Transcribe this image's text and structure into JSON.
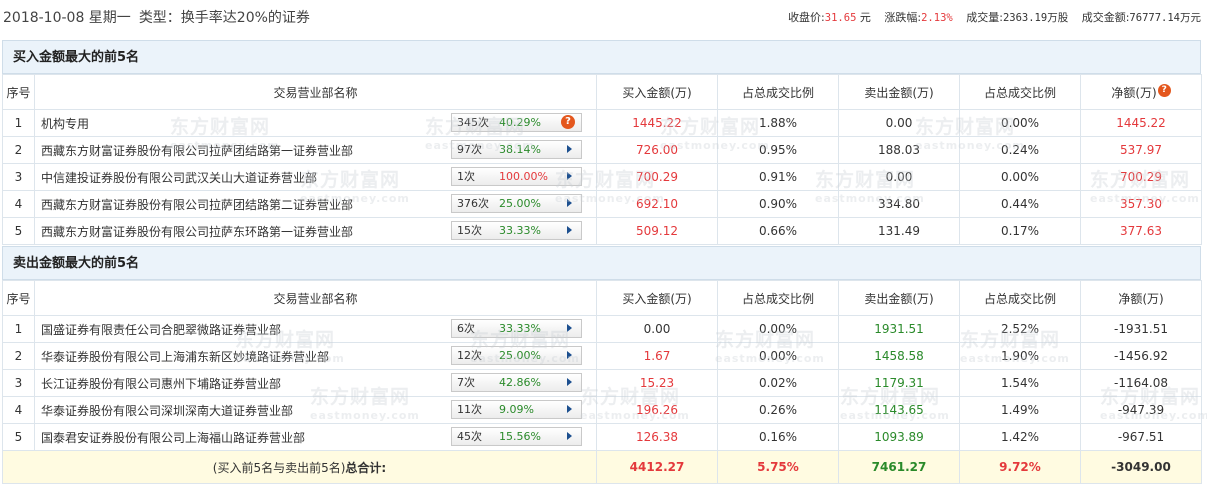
{
  "header": {
    "date": "2018-10-08 星期一",
    "type": "类型：换手率达20%的证券",
    "close_label": "收盘价:",
    "close_value": "31.65",
    "close_unit": "元",
    "change_label": "涨跌幅:",
    "change_value": "2.13%",
    "volume_label": "成交量:",
    "volume_value": "2363.19万股",
    "amount_label": "成交金额:",
    "amount_value": "76777.14万元"
  },
  "columns": {
    "seq": "序号",
    "name": "交易营业部名称",
    "buy": "买入金额(万)",
    "buy_pct": "占总成交比例",
    "sell": "卖出金额(万)",
    "sell_pct": "占总成交比例",
    "net": "净额(万)"
  },
  "buy_section": {
    "title": "买入金额最大的前5名",
    "rows": [
      {
        "seq": "1",
        "name": "机构专用",
        "count": "345次",
        "rate": "40.29%",
        "buy": "1445.22",
        "buy_pct": "1.88%",
        "sell": "0.00",
        "sell_pct": "0.00%",
        "net": "1445.22"
      },
      {
        "seq": "2",
        "name": "西藏东方财富证券股份有限公司拉萨团结路第一证券营业部",
        "count": "97次",
        "rate": "38.14%",
        "buy": "726.00",
        "buy_pct": "0.95%",
        "sell": "188.03",
        "sell_pct": "0.24%",
        "net": "537.97"
      },
      {
        "seq": "3",
        "name": "中信建投证券股份有限公司武汉关山大道证券营业部",
        "count": "1次",
        "rate": "100.00%",
        "buy": "700.29",
        "buy_pct": "0.91%",
        "sell": "0.00",
        "sell_pct": "0.00%",
        "net": "700.29"
      },
      {
        "seq": "4",
        "name": "西藏东方财富证券股份有限公司拉萨团结路第二证券营业部",
        "count": "376次",
        "rate": "25.00%",
        "buy": "692.10",
        "buy_pct": "0.90%",
        "sell": "334.80",
        "sell_pct": "0.44%",
        "net": "357.30"
      },
      {
        "seq": "5",
        "name": "西藏东方财富证券股份有限公司拉萨东环路第一证券营业部",
        "count": "15次",
        "rate": "33.33%",
        "buy": "509.12",
        "buy_pct": "0.66%",
        "sell": "131.49",
        "sell_pct": "0.17%",
        "net": "377.63"
      }
    ]
  },
  "sell_section": {
    "title": "卖出金额最大的前5名",
    "rows": [
      {
        "seq": "1",
        "name": "国盛证券有限责任公司合肥翠微路证券营业部",
        "count": "6次",
        "rate": "33.33%",
        "buy": "0.00",
        "buy_pct": "0.00%",
        "sell": "1931.51",
        "sell_pct": "2.52%",
        "net": "-1931.51"
      },
      {
        "seq": "2",
        "name": "华泰证券股份有限公司上海浦东新区妙境路证券营业部",
        "count": "12次",
        "rate": "25.00%",
        "buy": "1.67",
        "buy_pct": "0.00%",
        "sell": "1458.58",
        "sell_pct": "1.90%",
        "net": "-1456.92"
      },
      {
        "seq": "3",
        "name": "长江证券股份有限公司惠州下埔路证券营业部",
        "count": "7次",
        "rate": "42.86%",
        "buy": "15.23",
        "buy_pct": "0.02%",
        "sell": "1179.31",
        "sell_pct": "1.54%",
        "net": "-1164.08"
      },
      {
        "seq": "4",
        "name": "华泰证券股份有限公司深圳深南大道证券营业部",
        "count": "11次",
        "rate": "9.09%",
        "buy": "196.26",
        "buy_pct": "0.26%",
        "sell": "1143.65",
        "sell_pct": "1.49%",
        "net": "-947.39"
      },
      {
        "seq": "5",
        "name": "国泰君安证券股份有限公司上海福山路证券营业部",
        "count": "45次",
        "rate": "15.56%",
        "buy": "126.38",
        "buy_pct": "0.16%",
        "sell": "1093.89",
        "sell_pct": "1.42%",
        "net": "-967.51"
      }
    ]
  },
  "total": {
    "label_prefix": "(买入前5名与卖出前5名)",
    "label_bold": "总合计:",
    "buy": "4412.27",
    "buy_pct": "5.75%",
    "sell": "7461.27",
    "sell_pct": "9.72%",
    "net": "-3049.00"
  },
  "watermark": {
    "cn": "东方财富网",
    "en": "eastmoney.com"
  },
  "icons": {
    "arrow": "arrow-right-icon",
    "question": "question-icon"
  },
  "colors": {
    "up_red": "#e4393c",
    "pct_green": "#2a8a2a",
    "header_bg": "#ebf3fa",
    "total_bg": "#fffbe1"
  }
}
